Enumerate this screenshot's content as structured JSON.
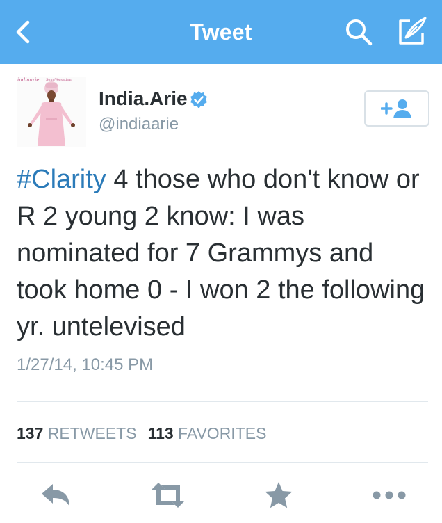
{
  "nav": {
    "title": "Tweet",
    "icons": [
      "back-chevron-icon",
      "search-icon",
      "compose-icon"
    ]
  },
  "avatar": {
    "overlay_text_a": "indiaarie",
    "overlay_text_b": "SongVersation"
  },
  "user": {
    "name": "India.Arie",
    "handle": "@indiaarie",
    "verified": true
  },
  "tweet": {
    "hashtag": "#Clarity",
    "body": " 4 those who don't know or R 2 young 2 know: I was nominated for 7 Grammys and took home 0 - I won 2 the following yr. untelevised",
    "timestamp": "1/27/14, 10:45 PM"
  },
  "stats": {
    "retweets_count": "137",
    "retweets_label": "RETWEETS",
    "favorites_count": "113",
    "favorites_label": "FAVORITES"
  },
  "actions": [
    "reply-icon",
    "retweet-icon",
    "favorite-icon",
    "more-icon"
  ],
  "colors": {
    "nav_bg": "#55acee",
    "link": "#2b7bb9",
    "text": "#292f33",
    "muted": "#8899a6",
    "icon_gray": "#8899a6",
    "divider": "#e1e8ed"
  }
}
